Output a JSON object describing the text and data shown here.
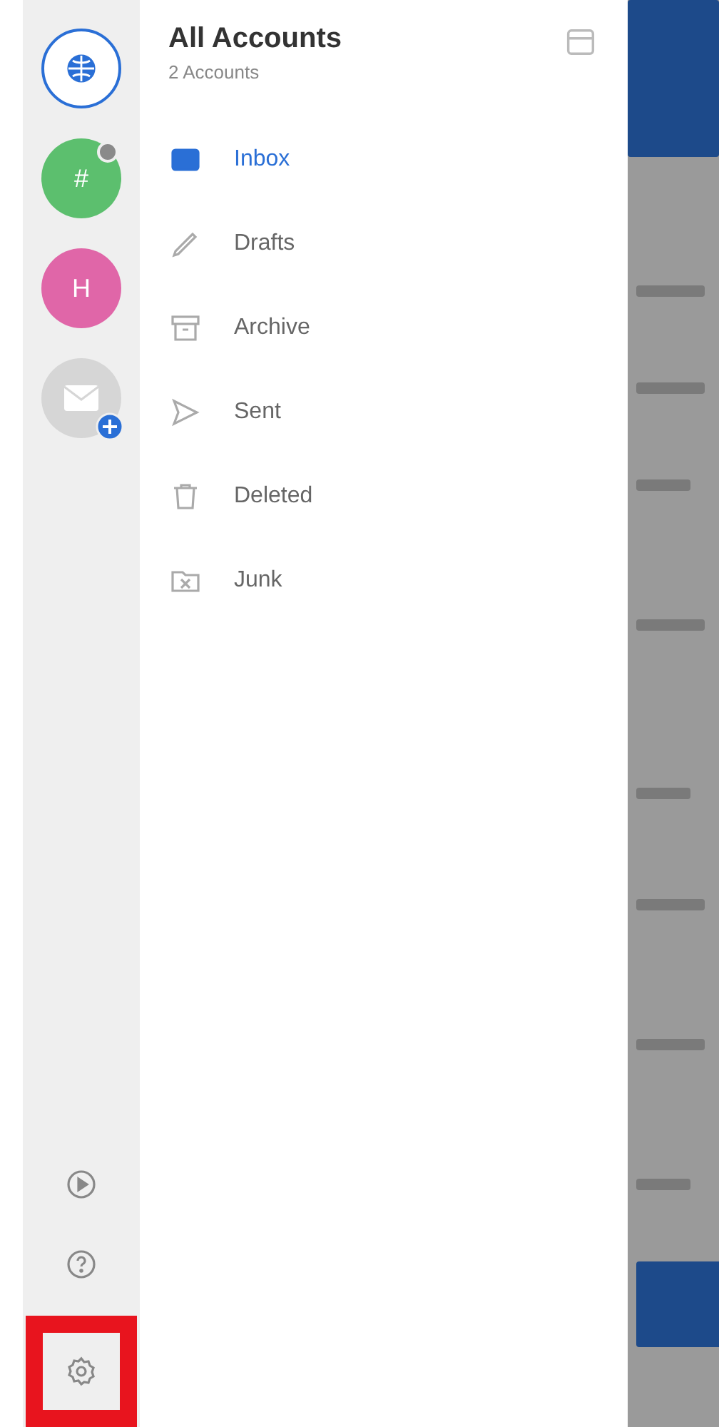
{
  "accounts": [
    {
      "kind": "all",
      "selected": true
    },
    {
      "kind": "initial",
      "label": "#",
      "color": "#5cbf6e",
      "status_dot": true,
      "selected": false
    },
    {
      "kind": "initial",
      "label": "H",
      "color": "#e066a8",
      "status_dot": false,
      "selected": false
    },
    {
      "kind": "add",
      "selected": false
    }
  ],
  "rail_actions": [
    {
      "kind": "play",
      "highlighted": false
    },
    {
      "kind": "help",
      "highlighted": false
    },
    {
      "kind": "settings",
      "highlighted": true
    }
  ],
  "header": {
    "title": "All Accounts",
    "subtitle": "2 Accounts"
  },
  "folders": [
    {
      "kind": "inbox",
      "label": "Inbox",
      "selected": true
    },
    {
      "kind": "drafts",
      "label": "Drafts",
      "selected": false
    },
    {
      "kind": "archive",
      "label": "Archive",
      "selected": false
    },
    {
      "kind": "sent",
      "label": "Sent",
      "selected": false
    },
    {
      "kind": "deleted",
      "label": "Deleted",
      "selected": false
    },
    {
      "kind": "junk",
      "label": "Junk",
      "selected": false
    }
  ]
}
